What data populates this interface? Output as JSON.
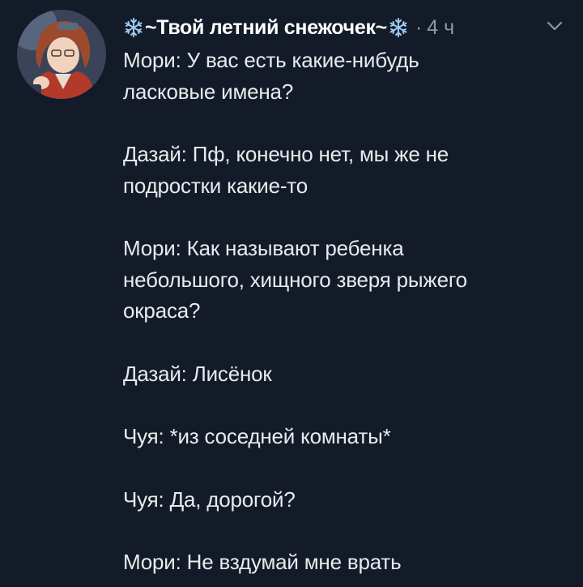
{
  "tweet": {
    "display_name": "~Твой летний снежочек~",
    "separator": "·",
    "time": "4 ч",
    "paragraphs": [
      [
        "Мори: У вас есть какие-нибудь",
        "ласковые имена?"
      ],
      [
        "Дазай: Пф, конечно нет, мы же не",
        "подростки какие-то"
      ],
      [
        "Мори: Как называют ребенка",
        "небольшого, хищного зверя рыжего",
        "окраса?"
      ],
      [
        "Дазай: Лисёнок"
      ],
      [
        "Чуя: *из соседней комнаты*"
      ],
      [
        "Чуя: Да, дорогой?"
      ],
      [
        "Мори: Не вздумай мне врать"
      ]
    ]
  },
  "colors": {
    "background": "#141b28",
    "text": "#e8eaed",
    "secondary": "#8b98a5",
    "snowflake": "#9ec9f0"
  },
  "icons": {
    "snowflake": "snowflake-icon",
    "more": "chevron-down-icon"
  }
}
